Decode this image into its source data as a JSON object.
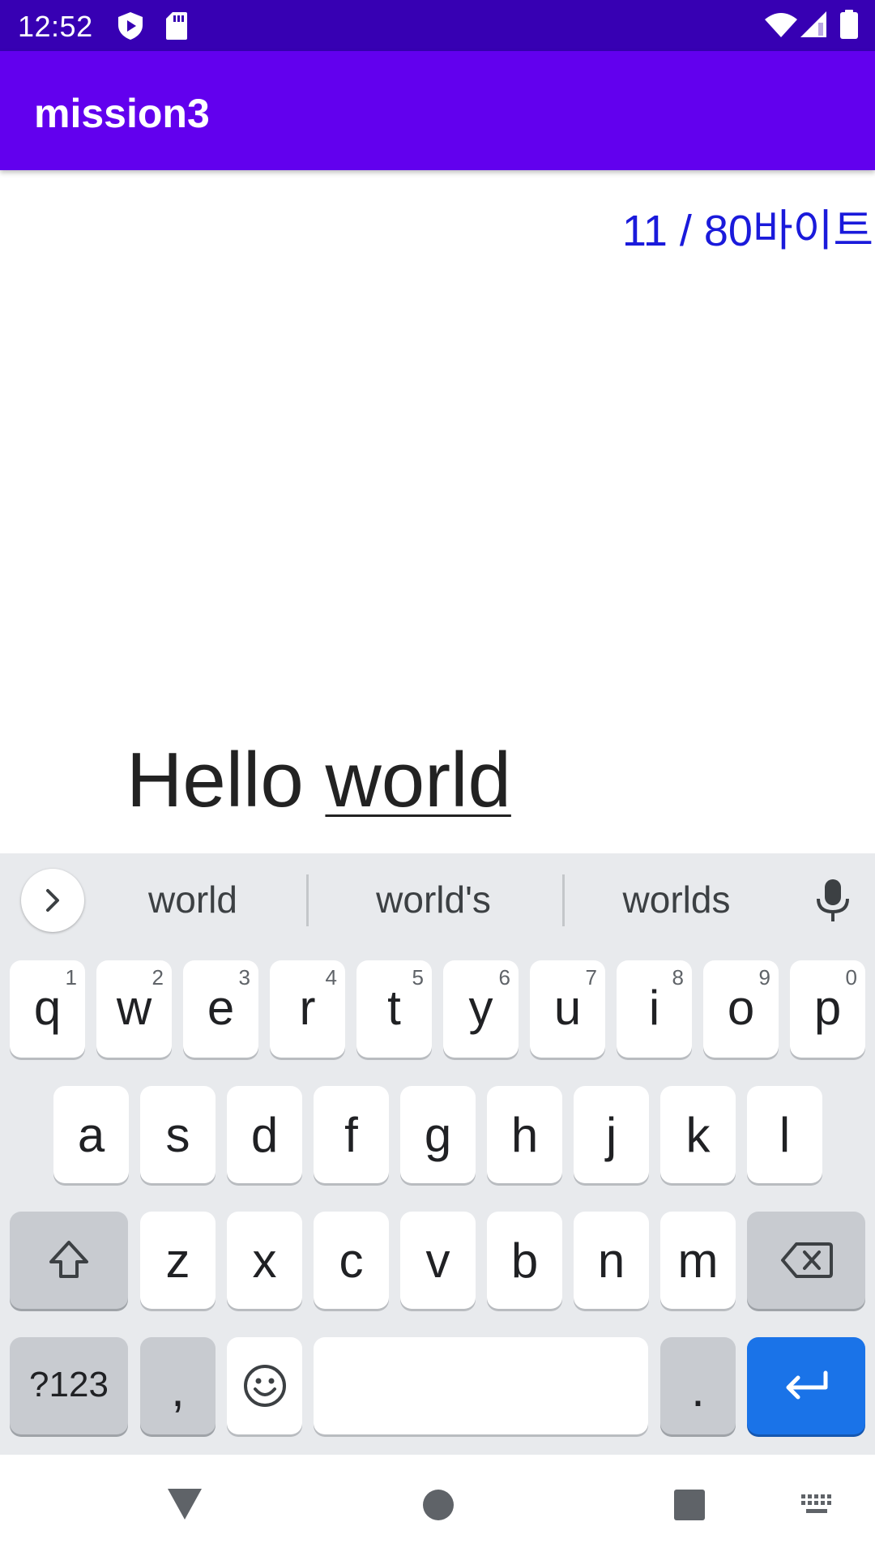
{
  "status_bar": {
    "time": "12:52"
  },
  "app_bar": {
    "title": "mission3"
  },
  "content": {
    "byte_counter": "11 / 80바이트",
    "input_word_1": "Hello",
    "input_word_2": "world"
  },
  "keyboard": {
    "suggestions": [
      "world",
      "world's",
      "worlds"
    ],
    "row1": [
      {
        "label": "q",
        "hint": "1"
      },
      {
        "label": "w",
        "hint": "2"
      },
      {
        "label": "e",
        "hint": "3"
      },
      {
        "label": "r",
        "hint": "4"
      },
      {
        "label": "t",
        "hint": "5"
      },
      {
        "label": "y",
        "hint": "6"
      },
      {
        "label": "u",
        "hint": "7"
      },
      {
        "label": "i",
        "hint": "8"
      },
      {
        "label": "o",
        "hint": "9"
      },
      {
        "label": "p",
        "hint": "0"
      }
    ],
    "row2": [
      "a",
      "s",
      "d",
      "f",
      "g",
      "h",
      "j",
      "k",
      "l"
    ],
    "row3": [
      "z",
      "x",
      "c",
      "v",
      "b",
      "n",
      "m"
    ],
    "symbols_label": "?123",
    "comma_label": ",",
    "period_label": ".",
    "accent_color": "#1a73e8"
  },
  "colors": {
    "status_bar": "#3700b3",
    "app_bar": "#6200ee",
    "byte_counter": "#1a1adb"
  }
}
